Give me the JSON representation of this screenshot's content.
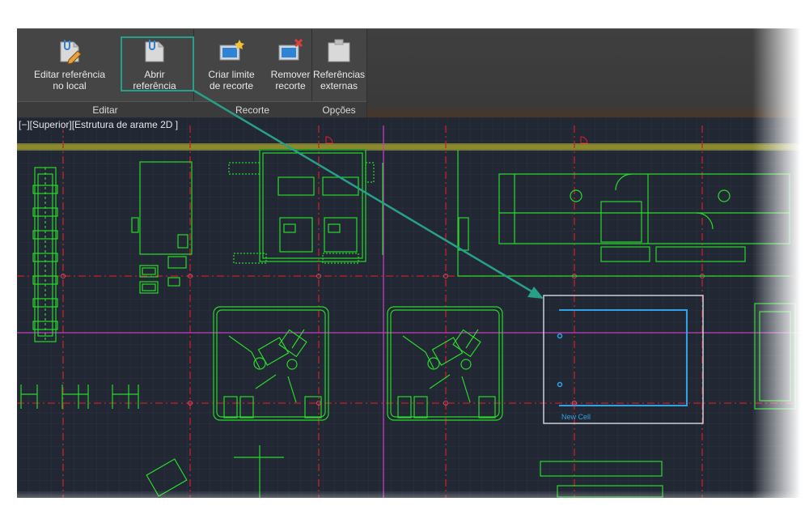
{
  "ribbon": {
    "panels": [
      {
        "title": "Editar"
      },
      {
        "title": "Recorte"
      },
      {
        "title": "Opções"
      }
    ],
    "buttons": {
      "edit_in_place": {
        "line1": "Editar referência",
        "line2": "no local"
      },
      "open_reference": {
        "line1": "Abrir",
        "line2": "referência"
      },
      "create_clip": {
        "line1": "Criar limite",
        "line2": "de recorte"
      },
      "remove_clip": {
        "line1": "Remover",
        "line2": "recorte"
      },
      "external_refs": {
        "line1": "Referências",
        "line2": "externas"
      }
    }
  },
  "viewport": {
    "label": "[−][Superior][Estrutura de arame 2D ]",
    "cell_label": "New Cell"
  },
  "colors": {
    "ribbon_bg": "#454545",
    "canvas_bg": "#212733",
    "geometry": "#2bd92b",
    "highlight": "#27a08a",
    "grid_red": "#c8202a",
    "magenta": "#c040c0",
    "cell_blue": "#2ea3e6"
  }
}
